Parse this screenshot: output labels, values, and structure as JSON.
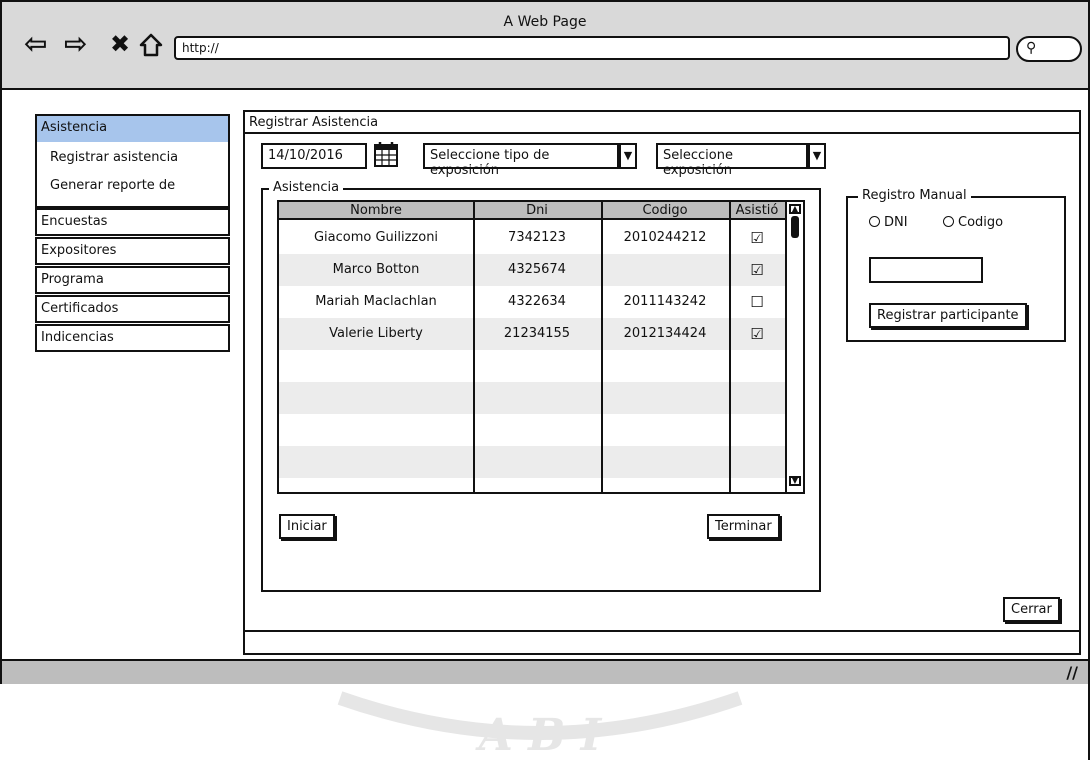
{
  "browser": {
    "title": "A Web Page",
    "url": "http://",
    "icons": {
      "back": "back-arrow-icon",
      "forward": "forward-arrow-icon",
      "stop": "close-icon",
      "home": "home-icon",
      "search": "search-icon",
      "resize": "resize-grip-icon"
    }
  },
  "sidebar": {
    "items": [
      {
        "label": "Asistencia",
        "active": true
      },
      {
        "label": "Encuestas"
      },
      {
        "label": "Expositores"
      },
      {
        "label": "Programa"
      },
      {
        "label": "Certificados"
      },
      {
        "label": "Indicencias"
      }
    ],
    "subitems": [
      {
        "label": "Registrar asistencia"
      },
      {
        "label": "Generar reporte de"
      }
    ],
    "active_color": "#a7c5ec"
  },
  "main": {
    "title": "Registrar Asistencia",
    "date": "14/10/2016",
    "type_select": "Seleccione tipo de exposición",
    "exposition_select": "Seleccione exposición",
    "asistencia_legend": "Asistencia",
    "table": {
      "headers": [
        "Nombre",
        "Dni",
        "Codigo",
        "Asistió"
      ],
      "rows": [
        {
          "nombre": "Giacomo Guilizzoni",
          "dni": "7342123",
          "codigo": "2010244212",
          "asistio": "☑"
        },
        {
          "nombre": "Marco Botton",
          "dni": "4325674",
          "codigo": "",
          "asistio": "☑"
        },
        {
          "nombre": "Mariah Maclachlan",
          "dni": "4322634",
          "codigo": "2011143242",
          "asistio": "☐"
        },
        {
          "nombre": "Valerie Liberty",
          "dni": "21234155",
          "codigo": "2012134424",
          "asistio": "☑"
        }
      ]
    },
    "iniciar": "Iniciar",
    "terminar": "Terminar",
    "manual": {
      "legend": "Registro Manual",
      "radio_dni": "DNI",
      "radio_codigo": "Codigo",
      "input_value": "",
      "button": "Registrar participante"
    },
    "cerrar": "Cerrar"
  }
}
